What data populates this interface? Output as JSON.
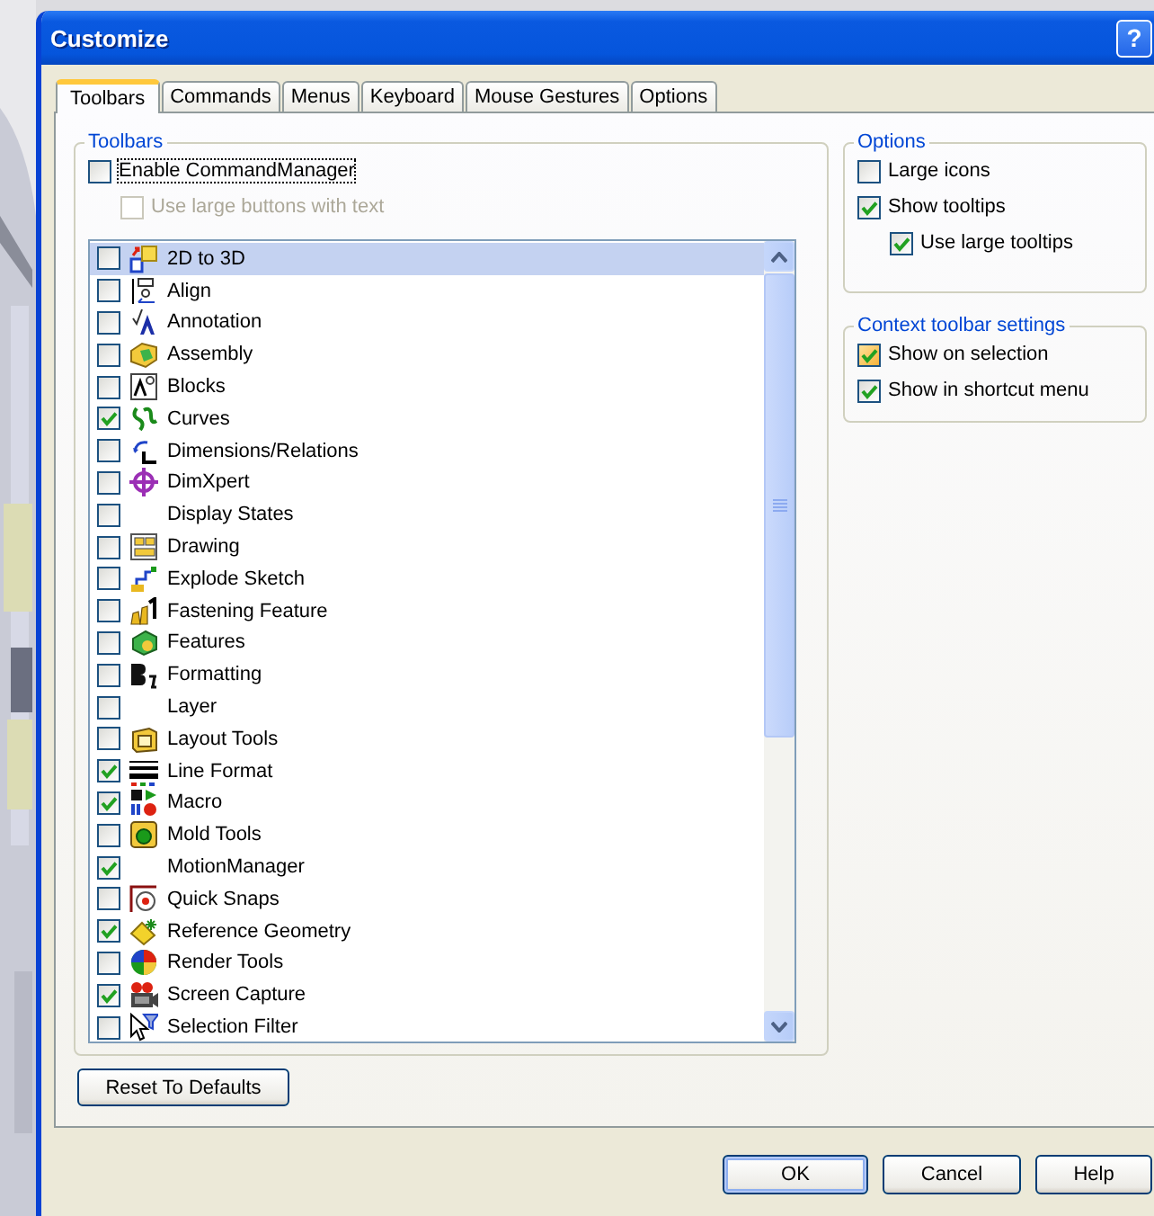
{
  "window": {
    "title": "Customize",
    "help_button": "?"
  },
  "tabs": [
    {
      "label": "Toolbars",
      "selected": true
    },
    {
      "label": "Commands",
      "selected": false
    },
    {
      "label": "Menus",
      "selected": false
    },
    {
      "label": "Keyboard",
      "selected": false
    },
    {
      "label": "Mouse Gestures",
      "selected": false
    },
    {
      "label": "Options",
      "selected": false
    }
  ],
  "toolbars_group": {
    "title": "Toolbars",
    "enable_commandmanager": {
      "label": "Enable CommandManager",
      "checked": false,
      "focused": true
    },
    "use_large_buttons": {
      "label": "Use large buttons with text",
      "checked": false,
      "disabled": true
    },
    "items": [
      {
        "label": "2D to 3D",
        "checked": false,
        "selected": true
      },
      {
        "label": "Align",
        "checked": false,
        "selected": false
      },
      {
        "label": "Annotation",
        "checked": false,
        "selected": false
      },
      {
        "label": "Assembly",
        "checked": false,
        "selected": false
      },
      {
        "label": "Blocks",
        "checked": false,
        "selected": false
      },
      {
        "label": "Curves",
        "checked": true,
        "selected": false
      },
      {
        "label": "Dimensions/Relations",
        "checked": false,
        "selected": false
      },
      {
        "label": "DimXpert",
        "checked": false,
        "selected": false
      },
      {
        "label": "Display States",
        "checked": false,
        "selected": false
      },
      {
        "label": "Drawing",
        "checked": false,
        "selected": false
      },
      {
        "label": "Explode Sketch",
        "checked": false,
        "selected": false
      },
      {
        "label": "Fastening Feature",
        "checked": false,
        "selected": false
      },
      {
        "label": "Features",
        "checked": false,
        "selected": false
      },
      {
        "label": "Formatting",
        "checked": false,
        "selected": false
      },
      {
        "label": "Layer",
        "checked": false,
        "selected": false
      },
      {
        "label": "Layout Tools",
        "checked": false,
        "selected": false
      },
      {
        "label": "Line Format",
        "checked": true,
        "selected": false
      },
      {
        "label": "Macro",
        "checked": true,
        "selected": false
      },
      {
        "label": "Mold Tools",
        "checked": false,
        "selected": false
      },
      {
        "label": "MotionManager",
        "checked": true,
        "selected": false
      },
      {
        "label": "Quick Snaps",
        "checked": false,
        "selected": false
      },
      {
        "label": "Reference Geometry",
        "checked": true,
        "selected": false
      },
      {
        "label": "Render Tools",
        "checked": false,
        "selected": false
      },
      {
        "label": "Screen Capture",
        "checked": true,
        "selected": false
      },
      {
        "label": "Selection Filter",
        "checked": false,
        "selected": false
      }
    ]
  },
  "options_group": {
    "title": "Options",
    "checkboxes": [
      {
        "label": "Large icons",
        "checked": false
      },
      {
        "label": "Show tooltips",
        "checked": true,
        "children": [
          {
            "label": "Use large tooltips",
            "checked": true
          }
        ]
      }
    ]
  },
  "context_group": {
    "title": "Context toolbar settings",
    "checkboxes": [
      {
        "label": "Show on selection",
        "checked": true,
        "hover": true
      },
      {
        "label": "Show in shortcut menu",
        "checked": true
      }
    ]
  },
  "reset_button": "Reset To Defaults",
  "buttons": [
    {
      "label": "OK",
      "default": true
    },
    {
      "label": "Cancel",
      "default": false
    },
    {
      "label": "Help",
      "default": false
    }
  ]
}
